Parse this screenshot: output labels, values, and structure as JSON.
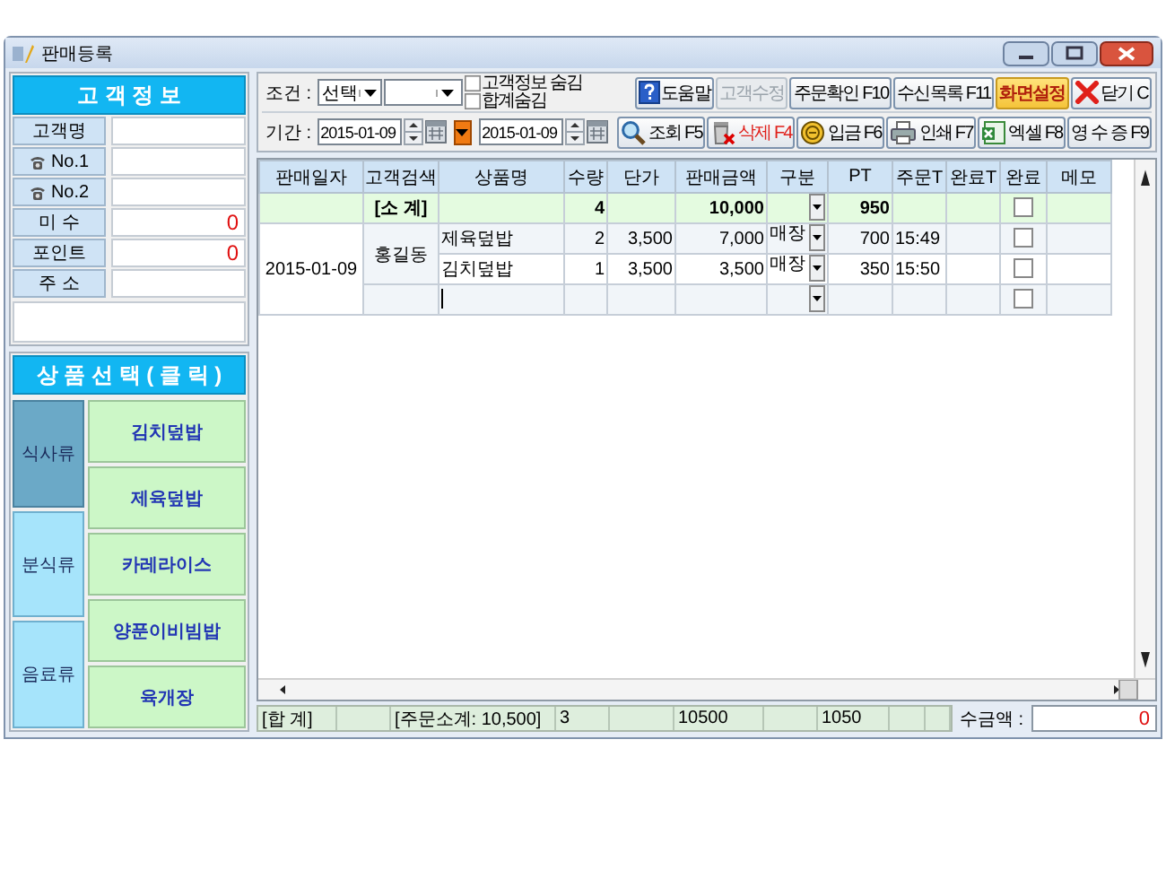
{
  "window": {
    "title": "판매등록"
  },
  "customer_info": {
    "title": "고 객 정 보",
    "fields": [
      {
        "label": "고객명"
      },
      {
        "label": "No.1"
      },
      {
        "label": "No.2"
      },
      {
        "label": "미 수",
        "value": "0"
      },
      {
        "label": "포인트",
        "value": "0"
      },
      {
        "label": "주 소"
      }
    ]
  },
  "product_select": {
    "title": "상 품 선 택 ( 클 릭 )",
    "categories": [
      {
        "label": "식사류",
        "selected": true
      },
      {
        "label": "분식류",
        "selected": false
      },
      {
        "label": "음료류",
        "selected": false
      }
    ],
    "products": [
      "김치덮밥",
      "제육덮밥",
      "카레라이스",
      "양푼이비빔밥",
      "육개장"
    ]
  },
  "toolbar": {
    "condition_label": "조건 :",
    "condition_value": "선택",
    "checkboxes": [
      {
        "label": "고객정보 숨김",
        "checked": false
      },
      {
        "label": "합계숨김",
        "checked": false
      }
    ],
    "period_label": "기간 :",
    "date_from": "2015-01-09",
    "date_to": "2015-01-09",
    "buttons_top": [
      {
        "label": "도움말",
        "kind": "normal"
      },
      {
        "label": "고객수정",
        "kind": "disabled"
      },
      {
        "label": "주문확인 F10",
        "kind": "normal"
      },
      {
        "label": "수신목록 F11",
        "kind": "normal"
      },
      {
        "label": "화면설정",
        "kind": "highlight"
      },
      {
        "label": "닫기 C",
        "kind": "normal"
      }
    ],
    "buttons_bottom": [
      {
        "label": "조회 F5",
        "kind": "normal"
      },
      {
        "label": "삭제 F4",
        "kind": "danger"
      },
      {
        "label": "입금 F6",
        "kind": "normal"
      },
      {
        "label": "인쇄 F7",
        "kind": "normal"
      },
      {
        "label": "엑셀 F8",
        "kind": "normal"
      },
      {
        "label": "영 수 증 F9",
        "kind": "normal"
      }
    ]
  },
  "grid": {
    "columns": [
      "판매일자",
      "고객검색",
      "상품명",
      "수량",
      "단가",
      "판매금액",
      "구분",
      "PT",
      "주문T",
      "완료T",
      "완료",
      "메모"
    ],
    "subtotal": {
      "label": "[소 계]",
      "qty": "4",
      "amount": "10,000",
      "pt": "950",
      "done": false
    },
    "groups": [
      {
        "date": "2015-01-09",
        "customer": "홍길동",
        "items": [
          {
            "product": "제육덮밥",
            "qty": "2",
            "price": "3,500",
            "amount": "7,000",
            "type": "매장",
            "pt": "700",
            "order_time": "15:49",
            "done": false
          },
          {
            "product": "김치덮밥",
            "qty": "1",
            "price": "3,500",
            "amount": "3,500",
            "type": "매장",
            "pt": "350",
            "order_time": "15:50",
            "done": false
          }
        ],
        "entry": {
          "done": false
        }
      }
    ]
  },
  "footer": {
    "label": "[합 계]",
    "order_subtotal": "[주문소계: 10,500]",
    "qty": "3",
    "amount": "10500",
    "pt": "1050",
    "received_label": "수금액 :",
    "received": "0"
  }
}
